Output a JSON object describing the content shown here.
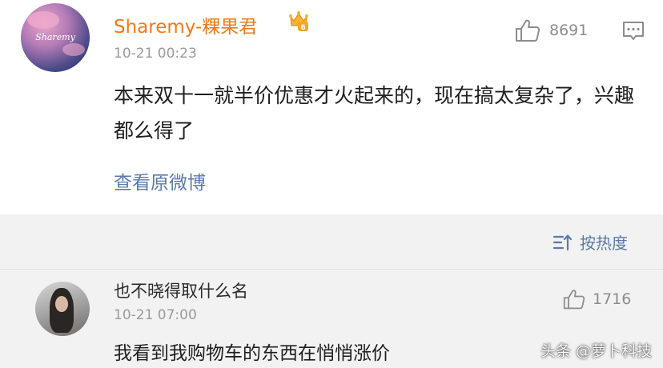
{
  "post": {
    "username": "Sharemy-粿果君",
    "avatar_text": "Sharemy",
    "badge_icon": "crown-badge-icon",
    "timestamp": "10-21 00:23",
    "likes": "8691",
    "content": "本来双十一就半价优惠才火起来的，现在搞太复杂了，兴趣都么得了",
    "view_original": "查看原微博",
    "colors": {
      "username": "#f07a18",
      "link": "#5a7aa8",
      "text": "#1e1e1e",
      "meta": "#9a9a9a"
    }
  },
  "sort": {
    "label": "按热度",
    "icon": "sort-icon"
  },
  "reply": {
    "username": "也不晓得取什么名",
    "timestamp": "10-21 07:00",
    "likes": "1716",
    "text": "我看到我购物车的东西在悄悄涨价"
  },
  "watermark": "头条 @萝卜科技"
}
